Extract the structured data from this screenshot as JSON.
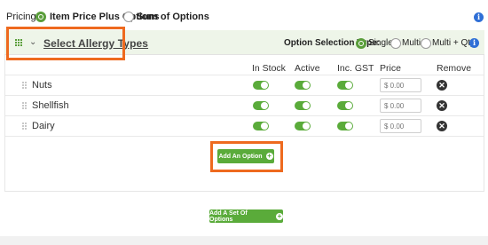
{
  "pricing": {
    "label": "Pricing:",
    "options": [
      {
        "label": "Item Price Plus Options",
        "selected": true
      },
      {
        "label": "Sum of Options",
        "selected": false
      }
    ]
  },
  "info_icon": "i",
  "option_set": {
    "title": "Select Allergy Types",
    "selection_type": {
      "label": "Option Selection Type:",
      "options": [
        {
          "label": "Single",
          "selected": true
        },
        {
          "label": "Multi",
          "selected": false
        },
        {
          "label": "Multi + Qty",
          "selected": false
        }
      ]
    },
    "columns": [
      "In Stock",
      "Active",
      "Inc. GST",
      "Price",
      "Remove"
    ],
    "rows": [
      {
        "name": "Nuts",
        "in_stock": true,
        "active": true,
        "inc_gst": true,
        "price_placeholder": "$ 0.00"
      },
      {
        "name": "Shellfish",
        "in_stock": true,
        "active": true,
        "inc_gst": true,
        "price_placeholder": "$ 0.00"
      },
      {
        "name": "Dairy",
        "in_stock": true,
        "active": true,
        "inc_gst": true,
        "price_placeholder": "$ 0.00"
      }
    ],
    "add_option_label": "Add An Option"
  },
  "add_set_label": "Add A Set Of Options",
  "colors": {
    "accent_green": "#5aab3a",
    "highlight_orange": "#ee6a1f",
    "info_blue": "#2f6fd6",
    "header_bg": "#eef5e9"
  }
}
